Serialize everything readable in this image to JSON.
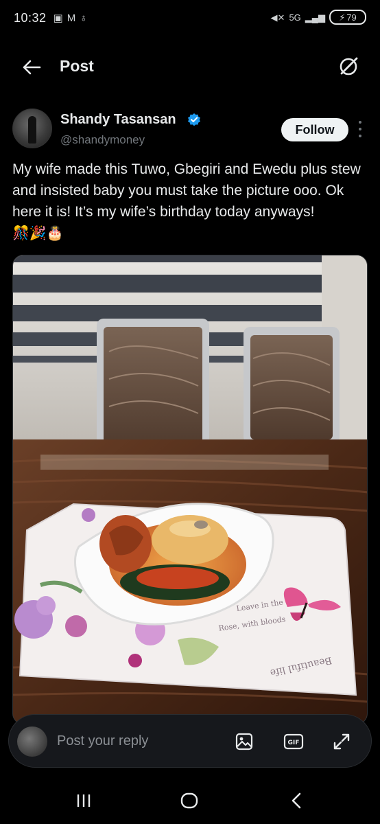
{
  "status_bar": {
    "time": "10:32",
    "left_icons": [
      "screenshot-icon",
      "gmail-icon",
      "hotspot-icon"
    ],
    "network": "5G",
    "battery": "79"
  },
  "header": {
    "title": "Post"
  },
  "post": {
    "author": {
      "name": "Shandy Tasansan",
      "handle": "@shandymoney",
      "verified": true
    },
    "follow_label": "Follow",
    "text": "My wife made this Tuwo, Gbegiri and Ewedu plus stew and insisted baby you must take the picture ooo. Ok here it is! It’s my wife’s birthday today anyways!",
    "emojis": "🎊🎉🎂",
    "media_tray_text": [
      "Rose, with bloods",
      "Leave in the",
      "Beautiful life"
    ]
  },
  "reply": {
    "placeholder": "Post your reply"
  },
  "colors": {
    "background": "#000000",
    "text": "#e7e9ea",
    "secondary": "#71767b",
    "verified_blue": "#1d9bf0",
    "follow_bg": "#eff3f4"
  }
}
